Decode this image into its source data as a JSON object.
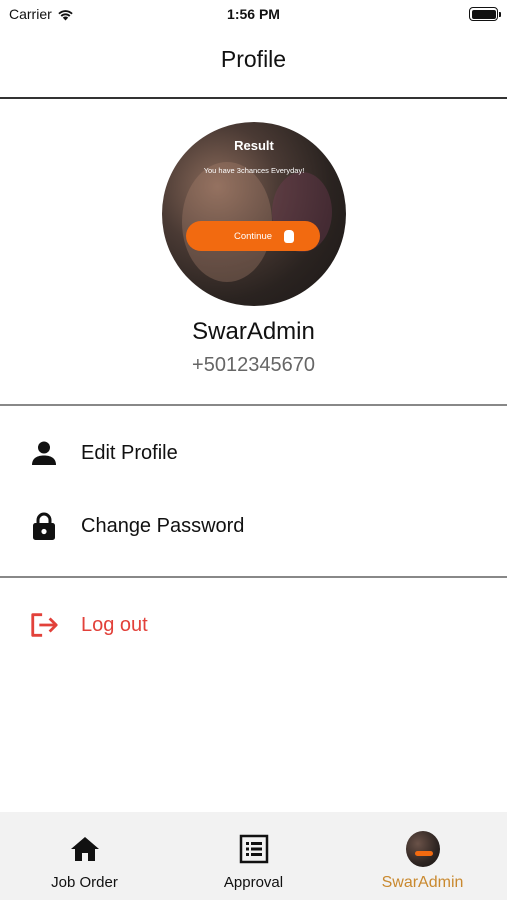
{
  "status_bar": {
    "carrier": "Carrier",
    "time": "1:56 PM"
  },
  "header": {
    "title": "Profile"
  },
  "profile": {
    "avatar_title": "Result",
    "avatar_subtitle": "You have 3chances Everyday!",
    "avatar_button": "Continue",
    "name": "SwarAdmin",
    "phone": "+5012345670"
  },
  "menu": {
    "edit_profile": "Edit Profile",
    "change_password": "Change Password",
    "logout": "Log out"
  },
  "tabs": [
    {
      "label": "Job Order",
      "icon": "home-icon",
      "active": false
    },
    {
      "label": "Approval",
      "icon": "list-icon",
      "active": false
    },
    {
      "label": "SwarAdmin",
      "icon": "avatar-icon",
      "active": true
    }
  ],
  "colors": {
    "accent": "#c9892f",
    "danger": "#e2413a",
    "orange_button": "#f26a10",
    "tab_bar_bg": "#f2f2f2"
  }
}
